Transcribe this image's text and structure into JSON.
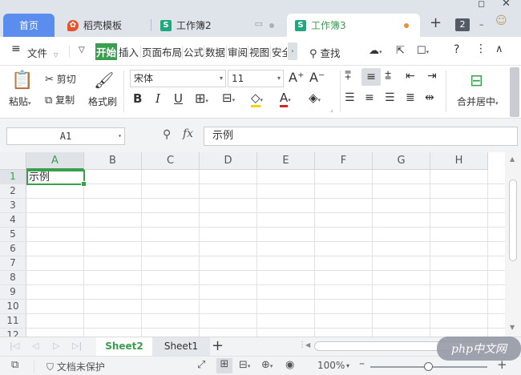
{
  "tabs": [
    {
      "label": "首页",
      "active": false
    },
    {
      "label": "稻壳模板",
      "active": false
    },
    {
      "label": "工作簿2",
      "active": false
    },
    {
      "label": "工作簿3",
      "active": true
    }
  ],
  "tab_count": "2",
  "menu": {
    "file_label": "文件",
    "ribbon_tabs": [
      "开始",
      "插入",
      "页面布局",
      "公式",
      "数据",
      "审阅",
      "视图",
      "安全"
    ],
    "search_label": "查找"
  },
  "ribbon": {
    "paste_label": "粘贴",
    "cut_label": "剪切",
    "copy_label": "复制",
    "format_painter_label": "格式刷",
    "font_name": "宋体",
    "font_size": "11",
    "merge_center_label": "合并居中"
  },
  "formula_bar": {
    "name_box": "A1",
    "fx_label": "fx",
    "formula_value": "示例"
  },
  "grid": {
    "columns": [
      "A",
      "B",
      "C",
      "D",
      "E",
      "F",
      "G",
      "H"
    ],
    "rows": [
      "1",
      "2",
      "3",
      "4",
      "5",
      "6",
      "7",
      "8",
      "9",
      "10",
      "11",
      "12"
    ],
    "selected_cell": "A1",
    "cell_a1": "示例"
  },
  "sheets": [
    {
      "name": "Sheet2",
      "active": true
    },
    {
      "name": "Sheet1",
      "active": false
    }
  ],
  "statusbar": {
    "protect_label": "文档未保护",
    "zoom": "100%",
    "zoom_fraction": 0.5
  },
  "watermark": "php中文网",
  "colors": {
    "accent_green": "#3a9e4f",
    "home_tab_blue": "#5b8def",
    "unsaved_dot": "#ef8c3c"
  }
}
